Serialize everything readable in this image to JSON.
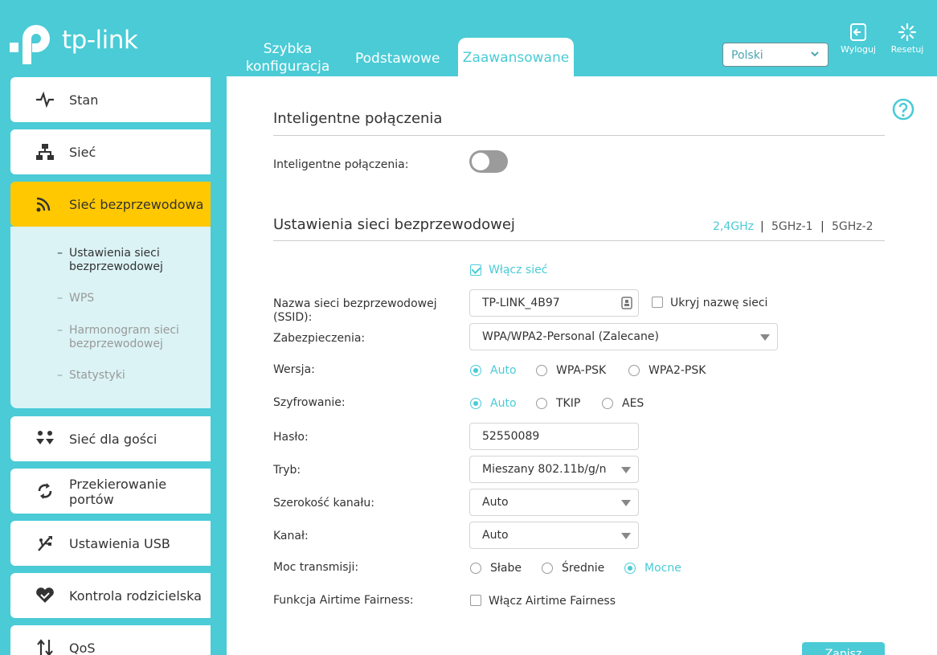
{
  "header": {
    "logo_text": "tp-link",
    "tabs": {
      "quick": "Szybka konfiguracja",
      "basic": "Podstawowe",
      "advanced": "Zaawansowane"
    },
    "language": "Polski",
    "logout": "Wyloguj",
    "reset": "Resetuj"
  },
  "sidebar": {
    "items": [
      {
        "label": "Stan",
        "icon": "pulse-icon"
      },
      {
        "label": "Sieć",
        "icon": "network-topology-icon"
      },
      {
        "label": "Sieć bezprzewodowa",
        "icon": "wireless-icon"
      },
      {
        "label": "Sieć dla gości",
        "icon": "guests-icon"
      },
      {
        "label": "Przekierowanie portów",
        "icon": "port-forward-icon"
      },
      {
        "label": "Ustawienia USB",
        "icon": "usb-icon"
      },
      {
        "label": "Kontrola rodzicielska",
        "icon": "heart-icon"
      },
      {
        "label": "QoS",
        "icon": "qos-arrows-icon"
      }
    ],
    "submenu": [
      "Ustawienia sieci bezprzewodowej",
      "WPS",
      "Harmonogram sieci bezprzewodowej",
      "Statystyki"
    ],
    "active_color": "#ffc800"
  },
  "main": {
    "smart_section_title": "Inteligentne połączenia",
    "smart_label": "Inteligentne połączenia:",
    "wireless_section_title": "Ustawienia sieci bezprzewodowej",
    "bands": [
      "2,4GHz",
      "5GHz-1",
      "5GHz-2"
    ],
    "band_separator": "|",
    "enable_network": "Włącz sieć",
    "ssid_label": "Nazwa sieci bezprzewodowej (SSID):",
    "ssid_value": "TP-LINK_4B97",
    "hide_ssid": "Ukryj nazwę sieci",
    "security_label": "Zabezpieczenia:",
    "security_value": "WPA/WPA2-Personal (Zalecane)",
    "version_label": "Wersja:",
    "version_options": [
      "Auto",
      "WPA-PSK",
      "WPA2-PSK"
    ],
    "encryption_label": "Szyfrowanie:",
    "encryption_options": [
      "Auto",
      "TKIP",
      "AES"
    ],
    "password_label": "Hasło:",
    "password_value": "52550089",
    "mode_label": "Tryb:",
    "mode_value": "Mieszany 802.11b/g/n",
    "width_label": "Szerokość kanału:",
    "width_value": "Auto",
    "channel_label": "Kanał:",
    "channel_value": "Auto",
    "power_label": "Moc transmisji:",
    "power_options": [
      "Słabe",
      "Średnie",
      "Mocne"
    ],
    "airtime_label": "Funkcja Airtime Fairness:",
    "airtime_option": "Włącz Airtime Fairness",
    "save": "Zapisz",
    "accent": "#4acbd6"
  }
}
